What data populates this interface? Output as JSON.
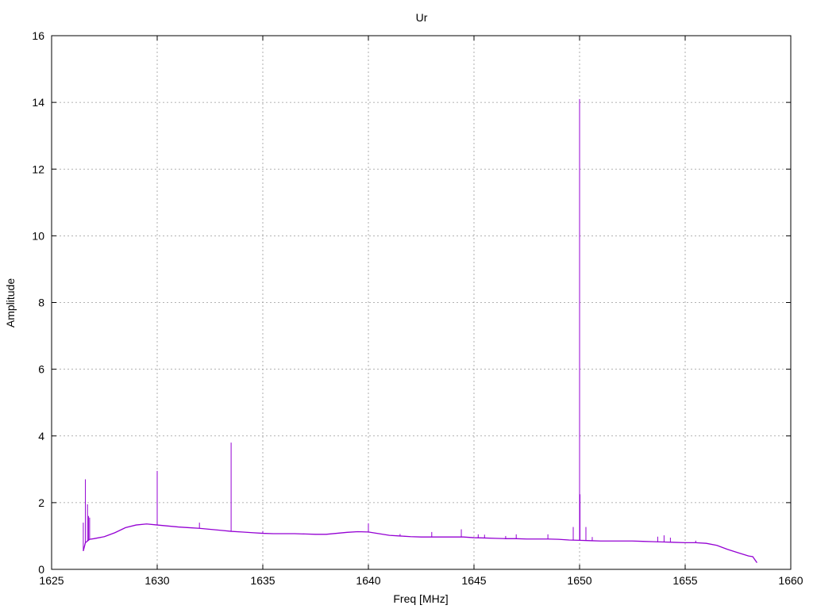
{
  "chart_data": {
    "type": "line",
    "title": "Ur",
    "xlabel": "Freq [MHz]",
    "ylabel": "Amplitude",
    "xlim": [
      1625,
      1660
    ],
    "ylim": [
      0,
      16
    ],
    "x_ticks": [
      1625,
      1630,
      1635,
      1640,
      1645,
      1650,
      1655,
      1660
    ],
    "y_ticks": [
      0,
      2,
      4,
      6,
      8,
      10,
      12,
      14,
      16
    ],
    "grid": true,
    "series": [
      {
        "color": "#9400d3",
        "baseline": [
          [
            1626.5,
            0.55
          ],
          [
            1626.6,
            0.8
          ],
          [
            1626.8,
            0.9
          ],
          [
            1627.0,
            0.92
          ],
          [
            1627.5,
            0.98
          ],
          [
            1628.0,
            1.1
          ],
          [
            1628.5,
            1.25
          ],
          [
            1629.0,
            1.33
          ],
          [
            1629.5,
            1.36
          ],
          [
            1630.0,
            1.33
          ],
          [
            1630.5,
            1.3
          ],
          [
            1631.0,
            1.27
          ],
          [
            1631.5,
            1.25
          ],
          [
            1632.0,
            1.23
          ],
          [
            1632.5,
            1.2
          ],
          [
            1633.0,
            1.17
          ],
          [
            1633.5,
            1.14
          ],
          [
            1634.0,
            1.12
          ],
          [
            1634.5,
            1.1
          ],
          [
            1635.0,
            1.08
          ],
          [
            1635.5,
            1.07
          ],
          [
            1636.0,
            1.07
          ],
          [
            1636.5,
            1.07
          ],
          [
            1637.0,
            1.06
          ],
          [
            1637.5,
            1.05
          ],
          [
            1638.0,
            1.05
          ],
          [
            1638.5,
            1.08
          ],
          [
            1639.0,
            1.11
          ],
          [
            1639.5,
            1.13
          ],
          [
            1640.0,
            1.12
          ],
          [
            1640.5,
            1.07
          ],
          [
            1641.0,
            1.02
          ],
          [
            1641.5,
            1.0
          ],
          [
            1642.0,
            0.98
          ],
          [
            1642.5,
            0.97
          ],
          [
            1643.0,
            0.97
          ],
          [
            1643.5,
            0.97
          ],
          [
            1644.0,
            0.97
          ],
          [
            1644.5,
            0.97
          ],
          [
            1645.0,
            0.95
          ],
          [
            1645.5,
            0.94
          ],
          [
            1646.0,
            0.93
          ],
          [
            1646.5,
            0.92
          ],
          [
            1647.0,
            0.92
          ],
          [
            1647.5,
            0.91
          ],
          [
            1648.0,
            0.91
          ],
          [
            1648.5,
            0.91
          ],
          [
            1649.0,
            0.9
          ],
          [
            1649.5,
            0.88
          ],
          [
            1650.0,
            0.87
          ],
          [
            1650.5,
            0.86
          ],
          [
            1651.0,
            0.85
          ],
          [
            1651.5,
            0.85
          ],
          [
            1652.0,
            0.85
          ],
          [
            1652.5,
            0.85
          ],
          [
            1653.0,
            0.84
          ],
          [
            1653.5,
            0.83
          ],
          [
            1654.0,
            0.82
          ],
          [
            1654.5,
            0.81
          ],
          [
            1655.0,
            0.8
          ],
          [
            1655.5,
            0.8
          ],
          [
            1656.0,
            0.78
          ],
          [
            1656.5,
            0.72
          ],
          [
            1657.0,
            0.6
          ],
          [
            1657.5,
            0.5
          ],
          [
            1658.0,
            0.4
          ],
          [
            1658.2,
            0.38
          ],
          [
            1658.4,
            0.2
          ]
        ],
        "spikes": [
          [
            1626.5,
            1.4
          ],
          [
            1626.6,
            2.7
          ],
          [
            1626.7,
            1.95
          ],
          [
            1626.75,
            1.6
          ],
          [
            1626.8,
            1.55
          ],
          [
            1630.0,
            2.95
          ],
          [
            1632.0,
            1.4
          ],
          [
            1633.5,
            3.8
          ],
          [
            1635.0,
            1.15
          ],
          [
            1640.0,
            1.38
          ],
          [
            1641.5,
            1.06
          ],
          [
            1643.0,
            1.12
          ],
          [
            1644.4,
            1.2
          ],
          [
            1645.2,
            1.05
          ],
          [
            1645.5,
            1.04
          ],
          [
            1646.5,
            1.0
          ],
          [
            1647.0,
            1.05
          ],
          [
            1648.5,
            1.05
          ],
          [
            1649.7,
            1.27
          ],
          [
            1650.0,
            14.1
          ],
          [
            1650.02,
            2.25
          ],
          [
            1650.3,
            1.27
          ],
          [
            1650.6,
            0.97
          ],
          [
            1653.7,
            0.98
          ],
          [
            1654.0,
            1.02
          ],
          [
            1654.3,
            0.95
          ],
          [
            1655.5,
            0.86
          ]
        ]
      }
    ]
  }
}
